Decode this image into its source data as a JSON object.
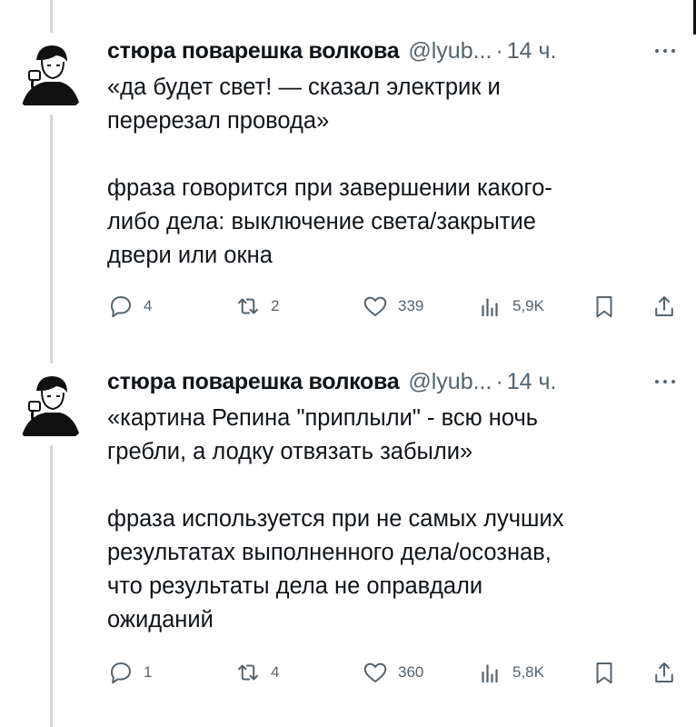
{
  "tweets": [
    {
      "author": "стюра поварешка волкова",
      "handle": "@lyub...",
      "separator": "·",
      "time": "14 ч.",
      "lines": [
        "«да будет свет! — сказал электрик и",
        "перерезал провода»",
        "",
        "фраза говорится при завершении какого-",
        "либо дела: выключение света/закрытие",
        "двери или окна"
      ],
      "actions": {
        "replies": "4",
        "reposts": "2",
        "likes": "339",
        "views": "5,9K"
      }
    },
    {
      "author": "стюра поварешка волкова",
      "handle": "@lyub...",
      "separator": "·",
      "time": "14 ч.",
      "lines": [
        "«картина Репина \"приплыли\" - всю ночь",
        "гребли, а лодку отвязать забыли»",
        "",
        "фраза используется при не самых лучших",
        "результатах выполненного дела/осознав,",
        "что результаты дела не оправдали",
        "ожиданий"
      ],
      "actions": {
        "replies": "1",
        "reposts": "4",
        "likes": "360",
        "views": "5,8K"
      }
    }
  ],
  "icons": {
    "reply": "reply-icon",
    "repost": "repost-icon",
    "like": "heart-icon",
    "views": "views-icon",
    "bookmark": "bookmark-icon",
    "share": "share-icon",
    "more": "more-icon"
  }
}
